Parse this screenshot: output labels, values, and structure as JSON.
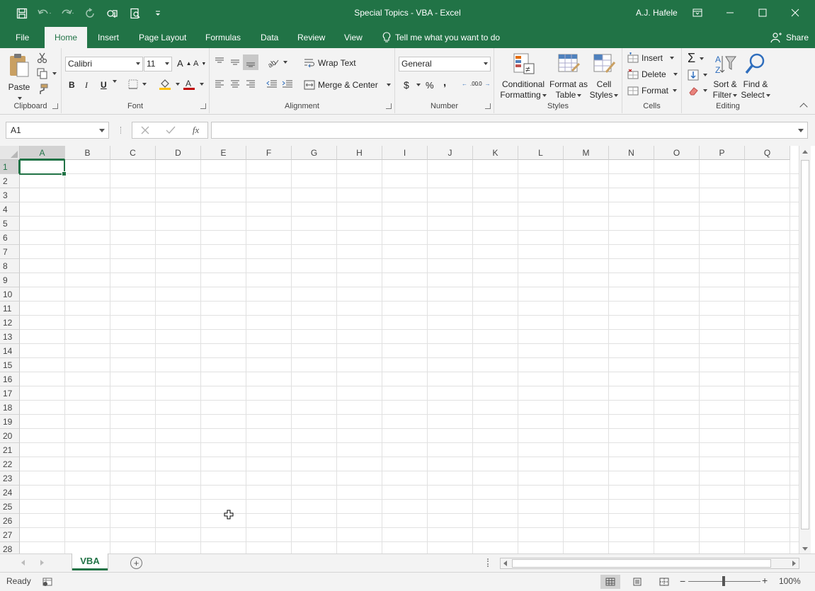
{
  "window": {
    "title": "Special Topics - VBA  -  Excel",
    "user": "A.J. Hafele"
  },
  "tabs": [
    "File",
    "Home",
    "Insert",
    "Page Layout",
    "Formulas",
    "Data",
    "Review",
    "View"
  ],
  "active_tab": "Home",
  "tell_me": "Tell me what you want to do",
  "share": "Share",
  "ribbon": {
    "clipboard": {
      "label": "Clipboard",
      "paste": "Paste"
    },
    "font": {
      "label": "Font",
      "font_name": "Calibri",
      "font_size": "11",
      "bold": "B",
      "italic": "I",
      "underline": "U"
    },
    "alignment": {
      "label": "Alignment",
      "wrap_text": "Wrap Text",
      "merge_center": "Merge & Center"
    },
    "number": {
      "label": "Number",
      "format": "General",
      "currency": "$",
      "percent": "%",
      "comma": ",",
      "inc_decimal": ".00",
      "dec_decimal": ".0"
    },
    "styles": {
      "label": "Styles",
      "conditional_1": "Conditional",
      "conditional_2": "Formatting",
      "table_1": "Format as",
      "table_2": "Table",
      "cell_1": "Cell",
      "cell_2": "Styles"
    },
    "cells": {
      "label": "Cells",
      "insert": "Insert",
      "delete": "Delete",
      "format": "Format"
    },
    "editing": {
      "label": "Editing",
      "sort_1": "Sort &",
      "sort_2": "Filter",
      "find_1": "Find &",
      "find_2": "Select"
    }
  },
  "formula_bar": {
    "name_box": "A1",
    "formula": "",
    "fx": "fx"
  },
  "grid": {
    "columns": [
      "A",
      "B",
      "C",
      "D",
      "E",
      "F",
      "G",
      "H",
      "I",
      "J",
      "K",
      "L",
      "M",
      "N",
      "O",
      "P",
      "Q"
    ],
    "rows": [
      "1",
      "2",
      "3",
      "4",
      "5",
      "6",
      "7",
      "8",
      "9",
      "10",
      "11",
      "12",
      "13",
      "14",
      "15",
      "16",
      "17",
      "18",
      "19",
      "20",
      "21",
      "22",
      "23",
      "24",
      "25",
      "26",
      "27",
      "28"
    ],
    "active_cell": "A1"
  },
  "sheets": {
    "tabs": [
      "VBA"
    ],
    "active": "VBA",
    "add_label": "+"
  },
  "status": {
    "ready": "Ready",
    "zoom": "100%"
  },
  "colors": {
    "brand": "#217346",
    "ribbon_bg": "#f3f3f3"
  }
}
